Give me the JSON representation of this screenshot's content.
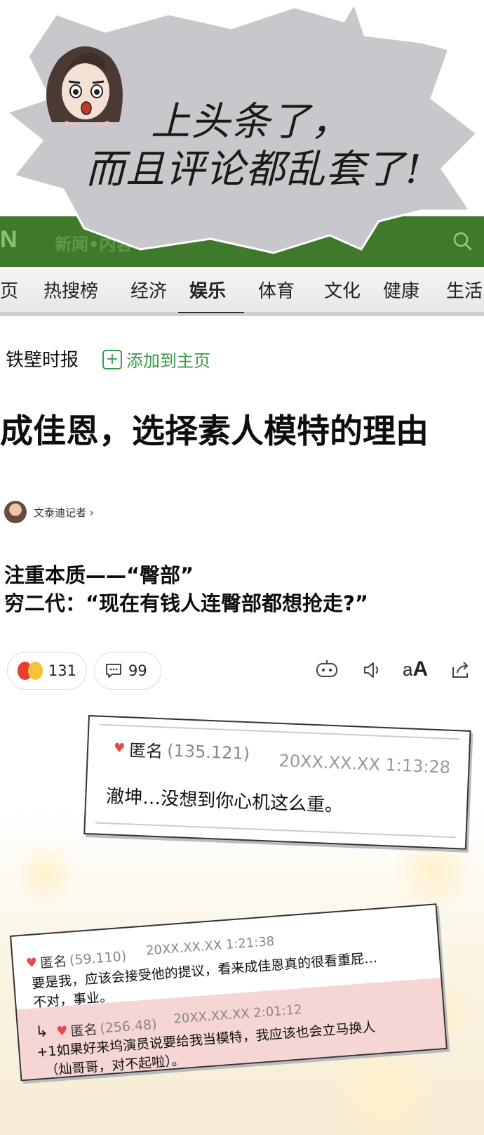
{
  "speech_bubble": {
    "line1": "上头条了，",
    "line2": "而且评论都乱套了!"
  },
  "app_header": {
    "logo": "N",
    "section": "新闻•内容"
  },
  "nav": {
    "tabs": [
      "页",
      "热搜榜",
      "经济",
      "娱乐",
      "体育",
      "文化",
      "健康",
      "生活"
    ],
    "active": "娱乐"
  },
  "article": {
    "press": "铁壁时报",
    "add_home": "添加到主页",
    "headline": "成佳恩，选择素人模特的理由",
    "reporter": "文泰迪记者 ›",
    "subhead1": "注重本质——“臀部”",
    "subhead2": "穷二代：“现在有钱人连臀部都想抢走?”"
  },
  "reactions": {
    "reaction_count": "131",
    "comment_count": "99",
    "font_size_label": "aA"
  },
  "comments": [
    {
      "name": "匿名",
      "ip": "(135.121)",
      "time": "20XX.XX.XX  1:13:28",
      "body": "澈坤…没想到你心机这么重。"
    },
    {
      "name": "匿名",
      "ip": "(59.110)",
      "time": "20XX.XX.XX  1:21:38",
      "body_line1": "要是我，应该会接受他的提议，看来成佳恩真的很看重屁…",
      "body_line2": "不对，事业。"
    },
    {
      "name": "匿名",
      "ip": "(256.48)",
      "time": "20XX.XX.XX  2:01:12",
      "body_line1": "+1如果好来坞演员说要给我当模特，我应该也会立马换人",
      "body_line2": "（灿哥哥，对不起啦）。"
    }
  ]
}
